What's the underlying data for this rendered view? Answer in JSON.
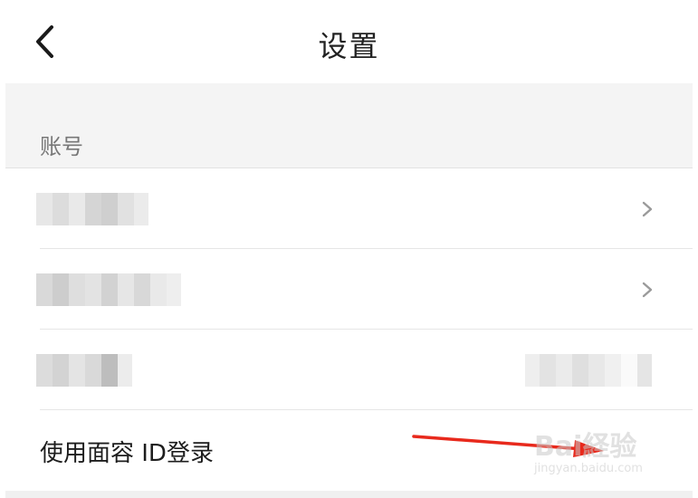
{
  "header": {
    "title": "设置",
    "back_icon": "chevron-left-icon"
  },
  "section": {
    "label": "账号"
  },
  "rows": [
    {
      "type": "redacted",
      "has_chevron": true
    },
    {
      "type": "redacted",
      "has_chevron": true
    },
    {
      "type": "redacted",
      "has_chevron": false
    },
    {
      "type": "text",
      "label": "使用面容 ID登录"
    }
  ],
  "annotation": {
    "arrow_color": "#e8291c"
  },
  "watermark": {
    "logo": "Bai経验",
    "url": "jingyan.baidu.com"
  }
}
